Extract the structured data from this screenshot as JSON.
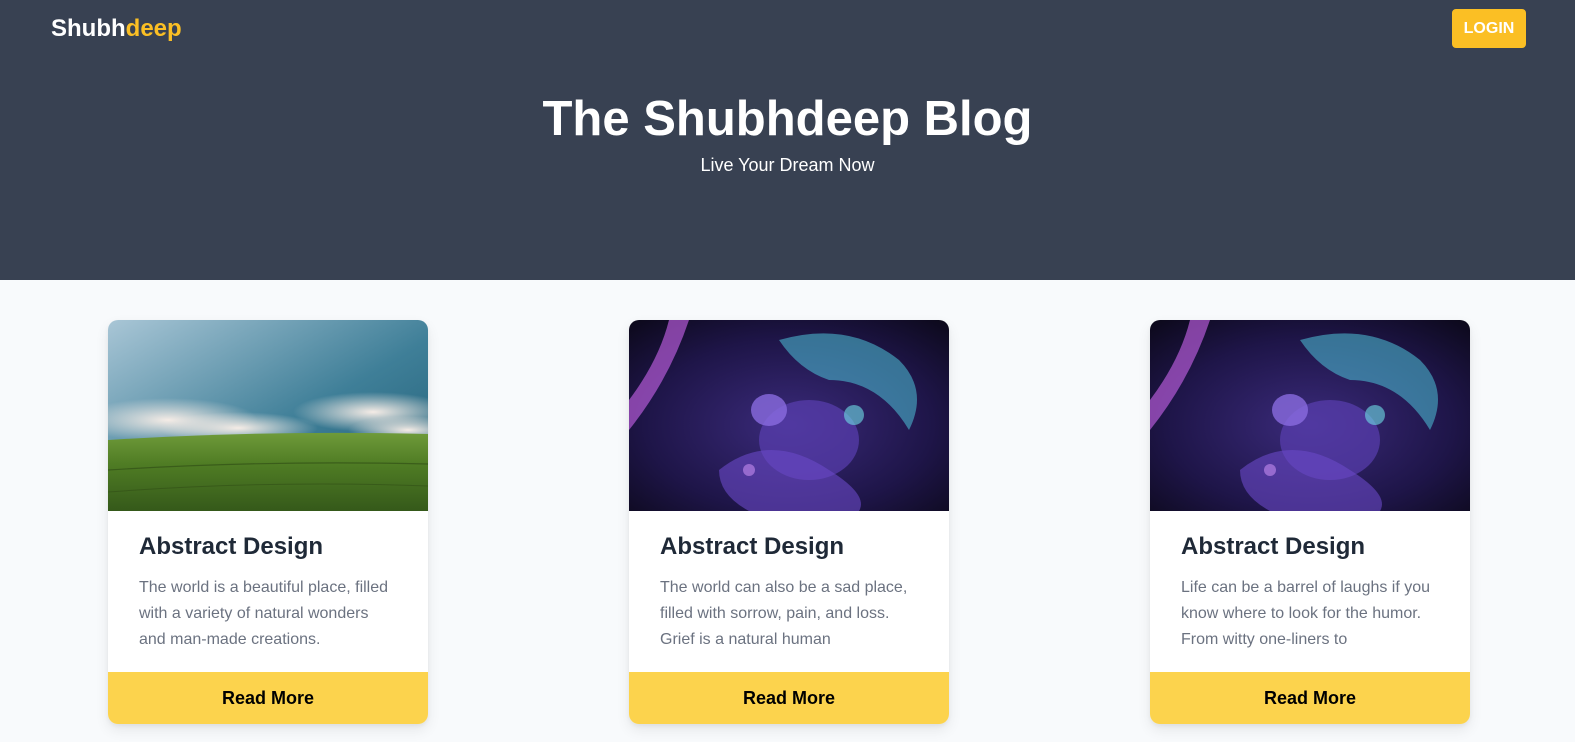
{
  "header": {
    "logo_main": "Shubh",
    "logo_accent": "deep",
    "login_label": "LOGIN"
  },
  "hero": {
    "title": "The Shubhdeep Blog",
    "subtitle": "Live Your Dream Now"
  },
  "cards": [
    {
      "title": "Abstract Design",
      "text": "The world is a beautiful place, filled with a variety of natural wonders and man-made creations.",
      "button": "Read More",
      "image": "green-field-landscape"
    },
    {
      "title": "Abstract Design",
      "text": "The world can also be a sad place, filled with sorrow, pain, and loss. Grief is a natural human",
      "button": "Read More",
      "image": "abstract-purple-fluid"
    },
    {
      "title": "Abstract Design",
      "text": "Life can be a barrel of laughs if you know where to look for the humor. From witty one-liners to",
      "button": "Read More",
      "image": "abstract-purple-fluid"
    }
  ],
  "colors": {
    "hero_bg": "#384152",
    "accent": "#fbbf24",
    "button_bg": "#fcd34d",
    "page_bg": "#f8fafc"
  }
}
